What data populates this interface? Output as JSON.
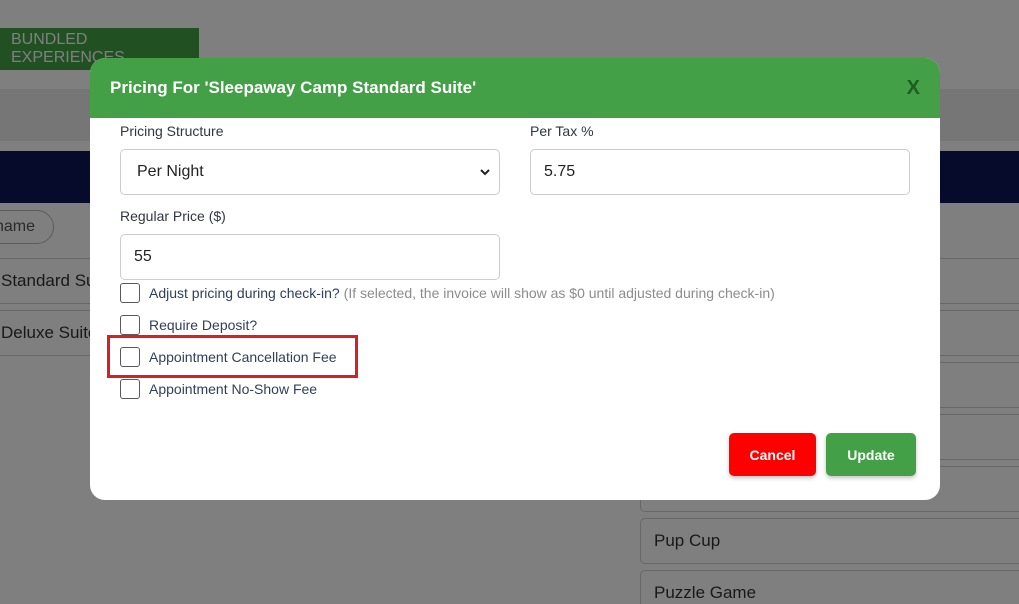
{
  "background": {
    "tab_label": "BUNDLED EXPERIENCES",
    "search_pill": "name",
    "left_items": [
      "Standard Suite",
      "Deluxe Suite"
    ],
    "right_items": [
      "Pup Cup",
      "Puzzle Game"
    ]
  },
  "modal": {
    "title": "Pricing For 'Sleepaway Camp Standard Suite'",
    "close_label": "X",
    "pricing_structure": {
      "label": "Pricing Structure",
      "selected": "Per Night"
    },
    "per_tax": {
      "label": "Per Tax %",
      "value": "5.75"
    },
    "regular_price": {
      "label": "Regular Price ($)",
      "value": "55"
    },
    "checkboxes": {
      "adjust_pricing": {
        "label": "Adjust pricing during check-in?",
        "note": "(If selected, the invoice will show as $0 until adjusted during check-in)"
      },
      "require_deposit": {
        "label": "Require Deposit?"
      },
      "cancellation_fee": {
        "label": "Appointment Cancellation Fee"
      },
      "no_show_fee": {
        "label": "Appointment No-Show Fee"
      }
    },
    "cancel_label": "Cancel",
    "update_label": "Update"
  },
  "colors": {
    "header_green": "#43a047",
    "cancel_red": "#ff0000",
    "highlight_red": "#d81f26",
    "navbar_navy": "#0d1656"
  }
}
